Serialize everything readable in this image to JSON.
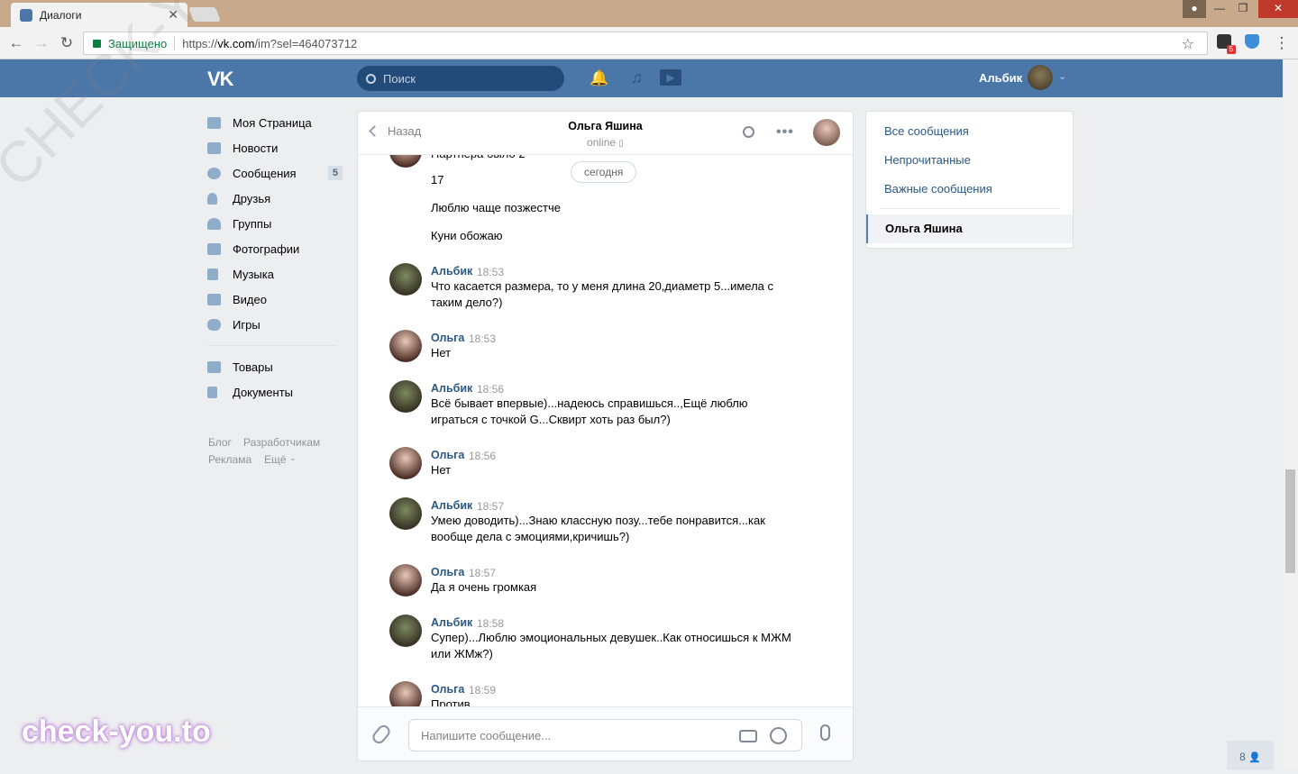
{
  "browser": {
    "tab_title": "Диалоги",
    "secure_label": "Защищено",
    "url_proto": "https://",
    "url_host": "vk.com",
    "url_path": "/im?sel=464073712",
    "ext_badge": "5"
  },
  "vk": {
    "logo": "VK",
    "search_placeholder": "Поиск",
    "user_name": "Альбик"
  },
  "menu": {
    "items": [
      {
        "label": "Моя Страница"
      },
      {
        "label": "Новости"
      },
      {
        "label": "Сообщения",
        "count": "5"
      },
      {
        "label": "Друзья"
      },
      {
        "label": "Группы"
      },
      {
        "label": "Фотографии"
      },
      {
        "label": "Музыка"
      },
      {
        "label": "Видео"
      },
      {
        "label": "Игры"
      }
    ],
    "items2": [
      {
        "label": "Товары"
      },
      {
        "label": "Документы"
      }
    ],
    "footer": {
      "blog": "Блог",
      "dev": "Разработчикам",
      "ads": "Реклама",
      "more": "Ещё"
    }
  },
  "chat": {
    "back_label": "Назад",
    "peer_name": "Ольга Яшина",
    "peer_status": "online",
    "today_label": "сегодня",
    "cut_text": "Партнера было 2",
    "messages": [
      {
        "author": "",
        "time": "",
        "lines": [
          "17"
        ]
      },
      {
        "author": "",
        "time": "",
        "lines": [
          "Люблю чаще позжестче"
        ]
      },
      {
        "author": "",
        "time": "",
        "lines": [
          "Куни обожаю"
        ]
      },
      {
        "author": "Альбик",
        "time": "18:53",
        "text": "Что касается размера, то у меня длина 20,диаметр 5...имела с таким дело?)"
      },
      {
        "author": "Ольга",
        "time": "18:53",
        "text": "Нет"
      },
      {
        "author": "Альбик",
        "time": "18:56",
        "text": "Всё бывает впервые)...надеюсь справишься..,Ещё люблю играться с точкой G...Сквирт хоть раз был?)"
      },
      {
        "author": "Ольга",
        "time": "18:56",
        "text": "Нет"
      },
      {
        "author": "Альбик",
        "time": "18:57",
        "text": "Умею доводить)...Знаю классную позу...тебе понравится...как вообще дела с эмоциями,кричишь?)"
      },
      {
        "author": "Ольга",
        "time": "18:57",
        "text": "Да я очень громкая"
      },
      {
        "author": "Альбик",
        "time": "18:58",
        "text": "Супер)...Люблю эмоциональных девушек..Как относишься к МЖМ или ЖМж?)"
      },
      {
        "author": "Ольга",
        "time": "18:59",
        "text": "Против"
      }
    ],
    "composer_placeholder": "Напишите сообщение..."
  },
  "right_panel": {
    "all": "Все сообщения",
    "unread": "Непрочитанные",
    "important": "Важные сообщения",
    "selected": "Ольга Яшина"
  },
  "watermark": "check-you.to",
  "watermark_diag": "CHECK-YOU.ME",
  "online_count": "8"
}
